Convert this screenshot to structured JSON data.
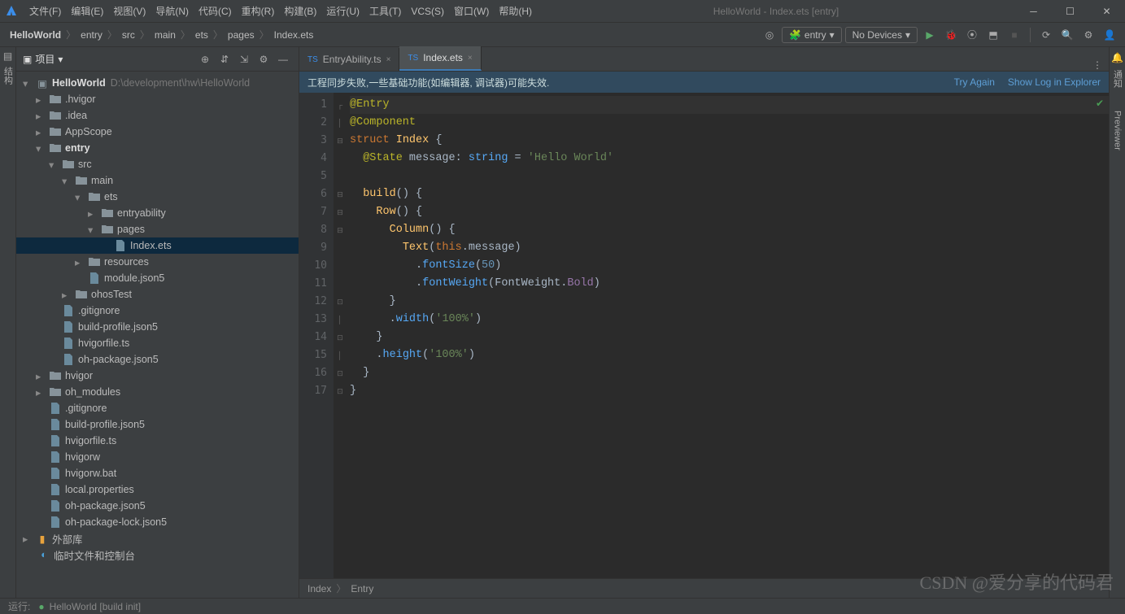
{
  "app": {
    "title": "HelloWorld - Index.ets [entry]"
  },
  "menu": {
    "file": "文件(F)",
    "edit": "编辑(E)",
    "view": "视图(V)",
    "nav": "导航(N)",
    "code": "代码(C)",
    "refactor": "重构(R)",
    "build": "构建(B)",
    "run": "运行(U)",
    "tools": "工具(T)",
    "vcs": "VCS(S)",
    "window": "窗口(W)",
    "help": "帮助(H)"
  },
  "breadcrumb": [
    "HelloWorld",
    "entry",
    "src",
    "main",
    "ets",
    "pages",
    "Index.ets"
  ],
  "run_config": {
    "selected": "entry",
    "devices": "No Devices"
  },
  "project": {
    "panel_label": "项目",
    "root": "HelloWorld",
    "root_path": "D:\\development\\hw\\HelloWorld",
    "items": [
      {
        "label": ".hvigor",
        "depth": 1,
        "kind": "folder",
        "expandable": true
      },
      {
        "label": ".idea",
        "depth": 1,
        "kind": "folder",
        "expandable": true
      },
      {
        "label": "AppScope",
        "depth": 1,
        "kind": "folder",
        "expandable": true
      },
      {
        "label": "entry",
        "depth": 1,
        "kind": "folder",
        "bold": true,
        "open": true,
        "expandable": true
      },
      {
        "label": "src",
        "depth": 2,
        "kind": "folder",
        "open": true,
        "expandable": true
      },
      {
        "label": "main",
        "depth": 3,
        "kind": "folder",
        "open": true,
        "expandable": true
      },
      {
        "label": "ets",
        "depth": 4,
        "kind": "folder",
        "open": true,
        "expandable": true
      },
      {
        "label": "entryability",
        "depth": 5,
        "kind": "folder",
        "expandable": true
      },
      {
        "label": "pages",
        "depth": 5,
        "kind": "folder",
        "open": true,
        "expandable": true
      },
      {
        "label": "Index.ets",
        "depth": 6,
        "kind": "file",
        "selected": true
      },
      {
        "label": "resources",
        "depth": 4,
        "kind": "folder",
        "expandable": true
      },
      {
        "label": "module.json5",
        "depth": 4,
        "kind": "file"
      },
      {
        "label": "ohosTest",
        "depth": 3,
        "kind": "folder",
        "expandable": true
      },
      {
        "label": ".gitignore",
        "depth": 2,
        "kind": "file"
      },
      {
        "label": "build-profile.json5",
        "depth": 2,
        "kind": "file"
      },
      {
        "label": "hvigorfile.ts",
        "depth": 2,
        "kind": "file"
      },
      {
        "label": "oh-package.json5",
        "depth": 2,
        "kind": "file"
      },
      {
        "label": "hvigor",
        "depth": 1,
        "kind": "folder",
        "expandable": true
      },
      {
        "label": "oh_modules",
        "depth": 1,
        "kind": "folder",
        "expandable": true
      },
      {
        "label": ".gitignore",
        "depth": 1,
        "kind": "file"
      },
      {
        "label": "build-profile.json5",
        "depth": 1,
        "kind": "file"
      },
      {
        "label": "hvigorfile.ts",
        "depth": 1,
        "kind": "file"
      },
      {
        "label": "hvigorw",
        "depth": 1,
        "kind": "file"
      },
      {
        "label": "hvigorw.bat",
        "depth": 1,
        "kind": "file"
      },
      {
        "label": "local.properties",
        "depth": 1,
        "kind": "file"
      },
      {
        "label": "oh-package.json5",
        "depth": 1,
        "kind": "file"
      },
      {
        "label": "oh-package-lock.json5",
        "depth": 1,
        "kind": "file"
      }
    ],
    "external_label": "外部库",
    "scratch_label": "临时文件和控制台"
  },
  "tabs": [
    {
      "label": "EntryAbility.ts",
      "active": false
    },
    {
      "label": "Index.ets",
      "active": true
    }
  ],
  "banner": {
    "text": "工程同步失败,一些基础功能(如编辑器, 调试器)可能失效.",
    "try_again": "Try Again",
    "show_log": "Show Log in Explorer"
  },
  "editor": {
    "crumbs": [
      "Index",
      "Entry"
    ],
    "line_count": 17
  },
  "right_tools": {
    "notifications": "通知",
    "previewer": "Previewer"
  },
  "footer": {
    "run_label": "运行:",
    "build_label": "HelloWorld [build init]"
  },
  "watermark": "CSDN @爱分享的代码君"
}
